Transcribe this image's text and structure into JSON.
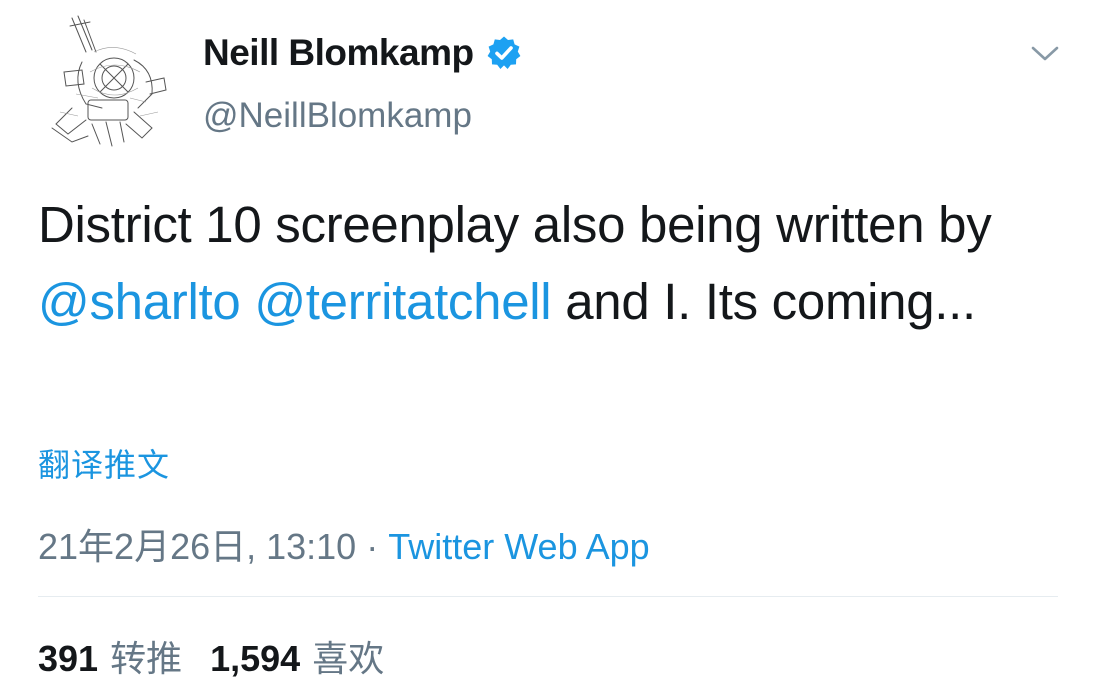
{
  "author": {
    "display_name": "Neill Blomkamp",
    "handle": "@NeillBlomkamp",
    "verified": true
  },
  "tweet": {
    "text_part1": "District 10 screenplay also being written by ",
    "mention1": "@sharlto",
    "text_part2": " ",
    "mention2": "@territatchell",
    "text_part3": " and I. Its coming..."
  },
  "translate_label": "翻译推文",
  "meta": {
    "timestamp": "21年2月26日, 13:10",
    "separator": "·",
    "source": "Twitter Web App"
  },
  "stats": {
    "retweets_count": "391",
    "retweets_label": "转推",
    "likes_count": "1,594",
    "likes_label": "喜欢"
  },
  "icons": {
    "verified": "verified-badge-icon",
    "menu": "chevron-down-icon",
    "avatar": "avatar-image"
  },
  "colors": {
    "link": "#1b95e0",
    "text": "#14171a",
    "secondary": "#657786",
    "divider": "#e6ecf0"
  }
}
